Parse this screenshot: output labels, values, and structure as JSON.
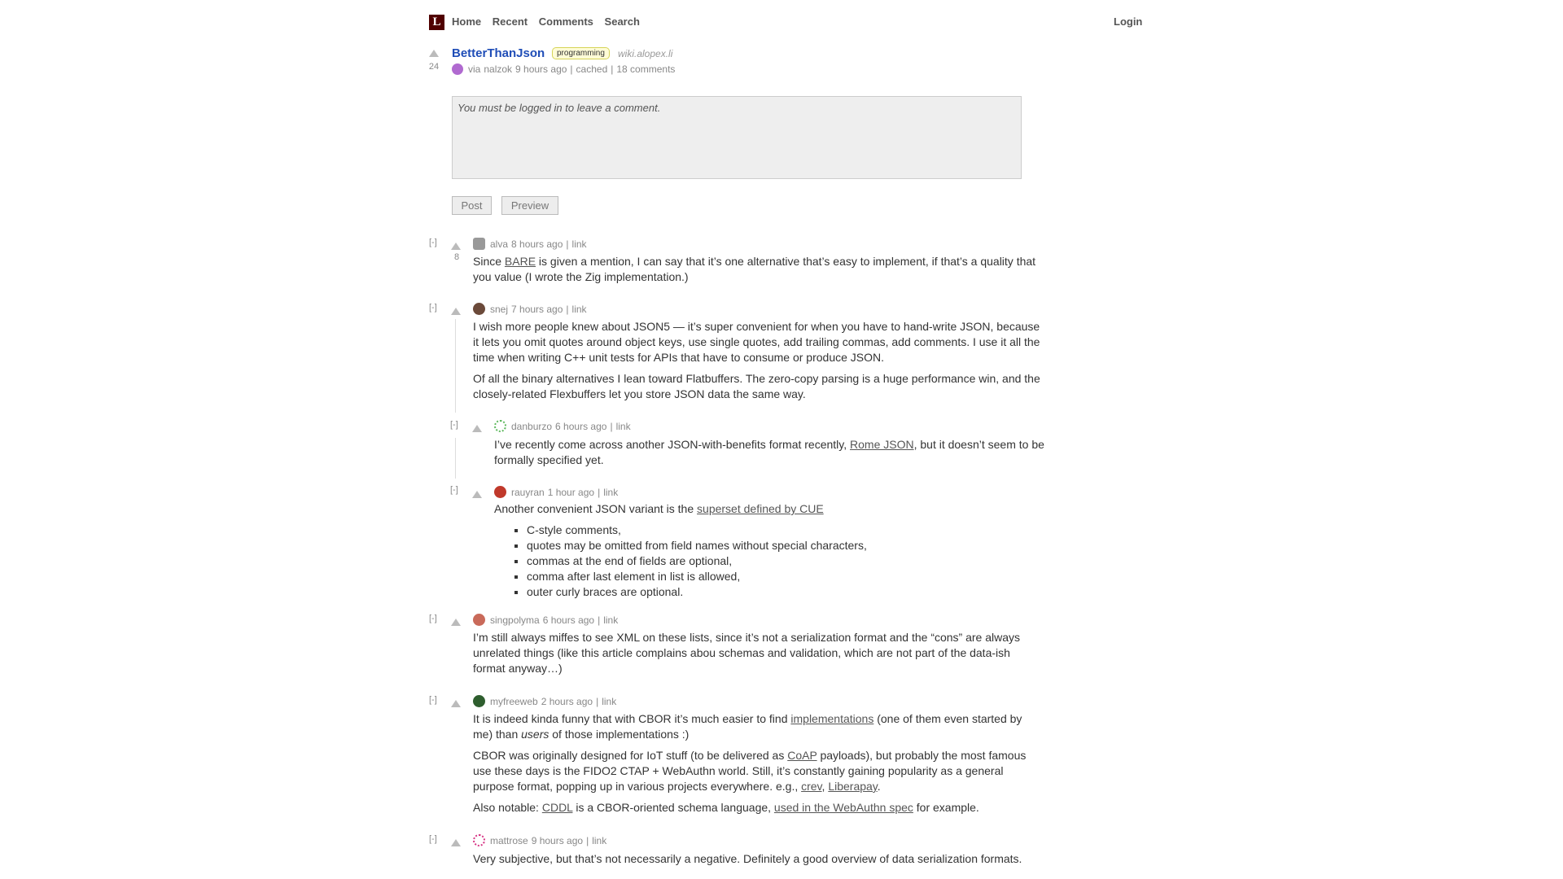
{
  "header": {
    "logo": "L",
    "nav": [
      "Home",
      "Recent",
      "Comments",
      "Search"
    ],
    "login": "Login"
  },
  "story": {
    "title": "BetterThanJson",
    "tag": "programming",
    "domain": "wiki.alopex.li",
    "score": "24",
    "via": "via",
    "user": "nalzok",
    "time": "9 hours ago",
    "cached": "cached",
    "comments": "18 comments"
  },
  "comment_box": {
    "placeholder": "You must be logged in to leave a comment.",
    "post": "Post",
    "preview": "Preview"
  },
  "comments": [
    {
      "toggle": "[-]",
      "user": "alva",
      "time": "8 hours ago",
      "link": "link",
      "score": "8",
      "avatar_color": "#999999",
      "p1_a": "Since ",
      "p1_link": "BARE",
      "p1_b": " is given a mention, I can say that it’s one alternative that’s easy to implement, if that’s a quality that you value (I wrote the Zig implementation.)"
    },
    {
      "toggle": "[-]",
      "user": "snej",
      "time": "7 hours ago",
      "link": "link",
      "avatar_color": "#6b4a3a",
      "p1": "I wish more people knew about JSON5 — it’s super convenient for when you have to hand-write JSON, because it lets you omit quotes around object keys, use single quotes, add trailing commas, add comments. I use it all the time when writing C++ unit tests for APIs that have to consume or produce JSON.",
      "p2": "Of all the binary alternatives I lean toward Flatbuffers. The zero-copy parsing is a huge performance win, and the closely-related Flexbuffers let you store JSON data the same way."
    },
    {
      "toggle": "[-]",
      "user": "danburzo",
      "time": "6 hours ago",
      "link": "link",
      "avatar_color": "#5cb85c",
      "p1_a": "I’ve recently come across another JSON-with-benefits format recently, ",
      "p1_link": "Rome JSON",
      "p1_b": ", but it doesn’t seem to be formally specified yet."
    },
    {
      "toggle": "[-]",
      "user": "rauyran",
      "time": "1 hour ago",
      "link": "link",
      "avatar_color": "#c0392b",
      "p1_a": "Another convenient JSON variant is the ",
      "p1_link": "superset defined by CUE",
      "items": [
        "C-style comments,",
        "quotes may be omitted from field names without special characters,",
        "commas at the end of fields are optional,",
        "comma after last element in list is allowed,",
        "outer curly braces are optional."
      ]
    },
    {
      "toggle": "[-]",
      "user": "singpolyma",
      "time": "6 hours ago",
      "link": "link",
      "avatar_color": "#c96a5a",
      "p1": "I’m still always miffes to see XML on these lists, since it’s not a serialization format and the “cons” are always unrelated things (like this article complains abou schemas and validation, which are not part of the data-ish format anyway…)"
    },
    {
      "toggle": "[-]",
      "user": "myfreeweb",
      "time": "2 hours ago",
      "link": "link",
      "avatar_color": "#2e5e2e",
      "p1_a": "It is indeed kinda funny that with CBOR it’s much easier to find ",
      "p1_link": "implementations",
      "p1_b": " (one of them even started by me) than ",
      "p1_em": "users",
      "p1_c": " of those implementations :)",
      "p2_a": "CBOR was originally designed for IoT stuff (to be delivered as ",
      "p2_link1": "CoAP",
      "p2_b": " payloads), but probably the most famous use these days is the FIDO2 CTAP + WebAuthn world. Still, it’s constantly gaining popularity as a general purpose format, popping up in various projects everywhere. e.g., ",
      "p2_link2": "crev",
      "p2_c": ", ",
      "p2_link3": "Liberapay",
      "p2_d": ".",
      "p3_a": "Also notable: ",
      "p3_link1": "CDDL",
      "p3_b": " is a CBOR-oriented schema language, ",
      "p3_link2": "used in the WebAuthn spec",
      "p3_c": " for example."
    },
    {
      "toggle": "[-]",
      "user": "mattrose",
      "time": "9 hours ago",
      "link": "link",
      "avatar_color": "#d63384",
      "p1": "Very subjective, but that’s not necessarily a negative. Definitely a good overview of data serialization formats."
    }
  ],
  "sep": "|"
}
